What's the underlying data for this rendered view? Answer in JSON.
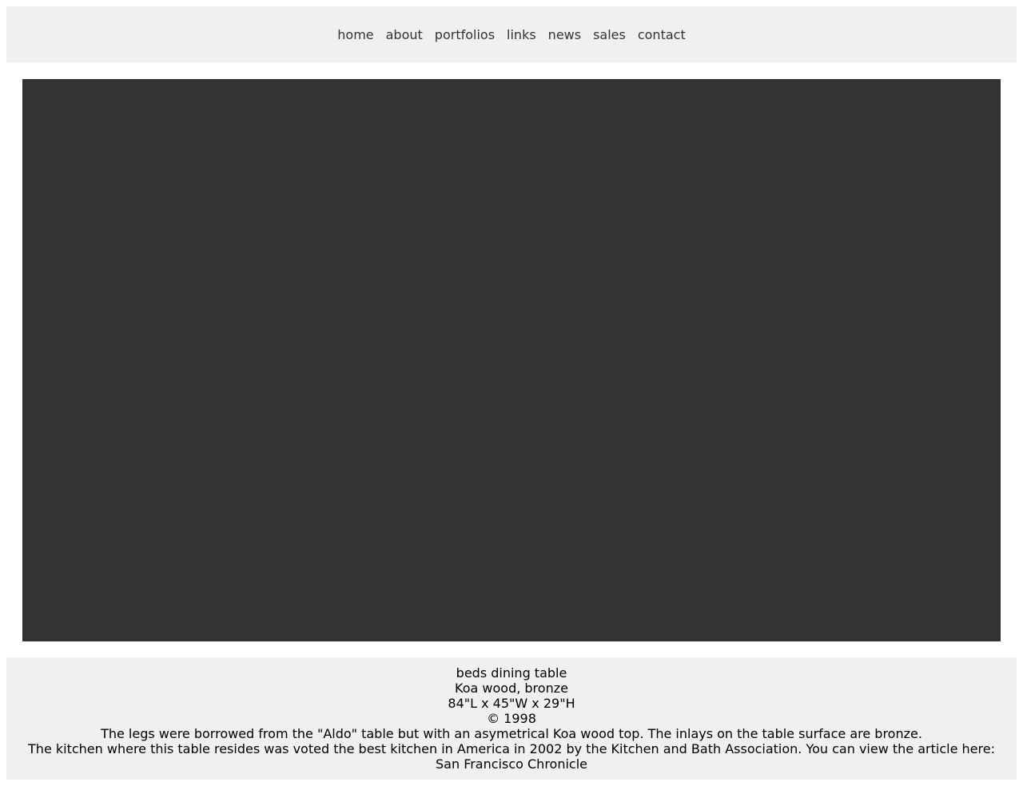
{
  "nav": {
    "items": [
      {
        "label": "home"
      },
      {
        "label": "about"
      },
      {
        "label": "portfolios"
      },
      {
        "label": "links"
      },
      {
        "label": "news"
      },
      {
        "label": "sales"
      },
      {
        "label": "contact"
      }
    ]
  },
  "colors": {
    "bar_background": "#f0f0f0",
    "image_placeholder": "#333333",
    "nav_text": "#333333",
    "caption_text": "#000000"
  },
  "caption": {
    "title": "beds dining table",
    "materials": "Koa wood, bronze",
    "dimensions": "84\"L x 45\"W x 29\"H",
    "copyright": "© 1998",
    "description": "The legs were borrowed from the \"Aldo\" table but with an asymetrical Koa wood top. The inlays on the table surface are bronze.",
    "kitchen_note": "The kitchen where this table resides was voted the best kitchen in America in 2002 by the Kitchen and Bath Association. You can view the article here:",
    "article_link": "San Francisco Chronicle"
  }
}
